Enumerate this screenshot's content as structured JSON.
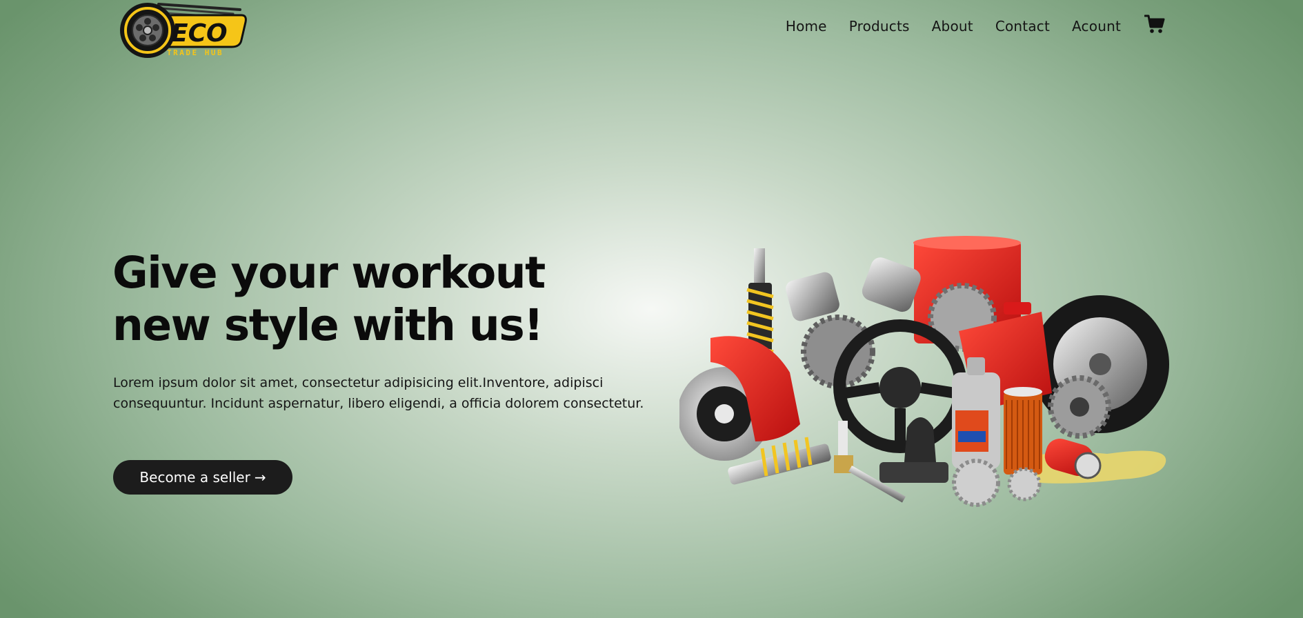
{
  "brand": {
    "name": "ECO",
    "tagline": "TRADE HUB"
  },
  "nav": {
    "items": [
      {
        "label": "Home"
      },
      {
        "label": "Products"
      },
      {
        "label": "About"
      },
      {
        "label": "Contact"
      },
      {
        "label": "Acount"
      }
    ],
    "cart_icon": "shopping-cart-icon"
  },
  "hero": {
    "title_line1": "Give your workout",
    "title_line2": "new style with us!",
    "description": "Lorem ipsum dolor sit amet, consectetur adipisicing elit.Inventore, adipisci consequuntur. Incidunt aspernatur, libero eligendi, a officia dolorem consectetur.",
    "cta_label": "Become a seller",
    "cta_arrow": "→"
  },
  "colors": {
    "background_center": "#f6f8f5",
    "background_edge": "#6a946c",
    "button": "#1c1c1c",
    "brand_yellow": "#f5c518",
    "parts_red": "#e01f1f"
  }
}
